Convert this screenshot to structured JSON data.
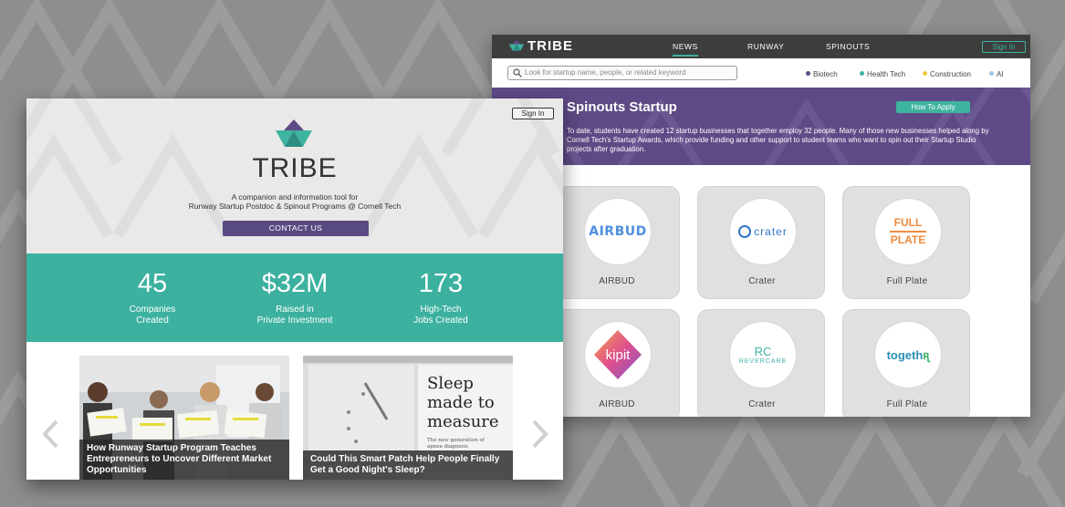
{
  "back_window": {
    "brand": "TRIBE",
    "nav_tabs": [
      "NEWS",
      "RUNWAY",
      "SPINOUTS"
    ],
    "active_tab": "NEWS",
    "sign_in": "Sign In",
    "search": {
      "placeholder": "Look for startup name, people, or related keyword"
    },
    "filters": [
      {
        "label": "Biotech",
        "color": "#5b4a8a"
      },
      {
        "label": "Health Tech",
        "color": "#3eb3a0"
      },
      {
        "label": "Construction",
        "color": "#f0c63e"
      },
      {
        "label": "AI",
        "color": "#9ec7e8"
      }
    ],
    "hero": {
      "title": "Spinouts Startup",
      "button": "How To Apply",
      "description": "To date, students have created 12 startup businesses that together employ 32 people. Many of those new businesses helped along by Cornell Tech's Startup Awards, which provide funding and other support to student teams who want to spin out their Startup Studio projects after graduation."
    },
    "startups": [
      {
        "name": "AIRBUD",
        "logo_text": "AIRBUD"
      },
      {
        "name": "Crater",
        "logo_text": "crater"
      },
      {
        "name": "Full Plate",
        "logo_text_1": "FULL",
        "logo_text_2": "PLATE"
      },
      {
        "name": "AIRBUD",
        "logo_text": "kipit"
      },
      {
        "name": "Crater",
        "logo_text_1": "RC",
        "logo_text_2": "REVERCARE"
      },
      {
        "name": "Full Plate",
        "logo_text": "togeth",
        "logo_accent": "ꭆ"
      }
    ]
  },
  "front_window": {
    "sign_in": "Sign In",
    "brand": "TRIBE",
    "tagline_1": "A companion and information tool for",
    "tagline_2": "Runway Startup Postdoc & Spinout Programs @ Cornell Tech",
    "contact_button": "CONTACT US",
    "stats": [
      {
        "value": "45",
        "label_1": "Companies",
        "label_2": "Created"
      },
      {
        "value": "$32M",
        "label_1": "Raised in",
        "label_2": "Private Investment"
      },
      {
        "value": "173",
        "label_1": "High-Tech",
        "label_2": "Jobs Created"
      }
    ],
    "articles": [
      {
        "caption": "How Runway Startup Program Teaches Entrepreneurs to Uncover Different Market Opportunities"
      },
      {
        "caption": "Could This Smart Patch Help People Finally Get a Good Night's Sleep?",
        "magazine_title": "Sleep made to measure",
        "magazine_subtitle": "The new generation of apnea diagnosis"
      }
    ]
  },
  "colors": {
    "teal": "#3db1a0",
    "purple": "#5e4a86",
    "dark_nav": "#3d3d3d",
    "background": "#8e8e8e"
  }
}
